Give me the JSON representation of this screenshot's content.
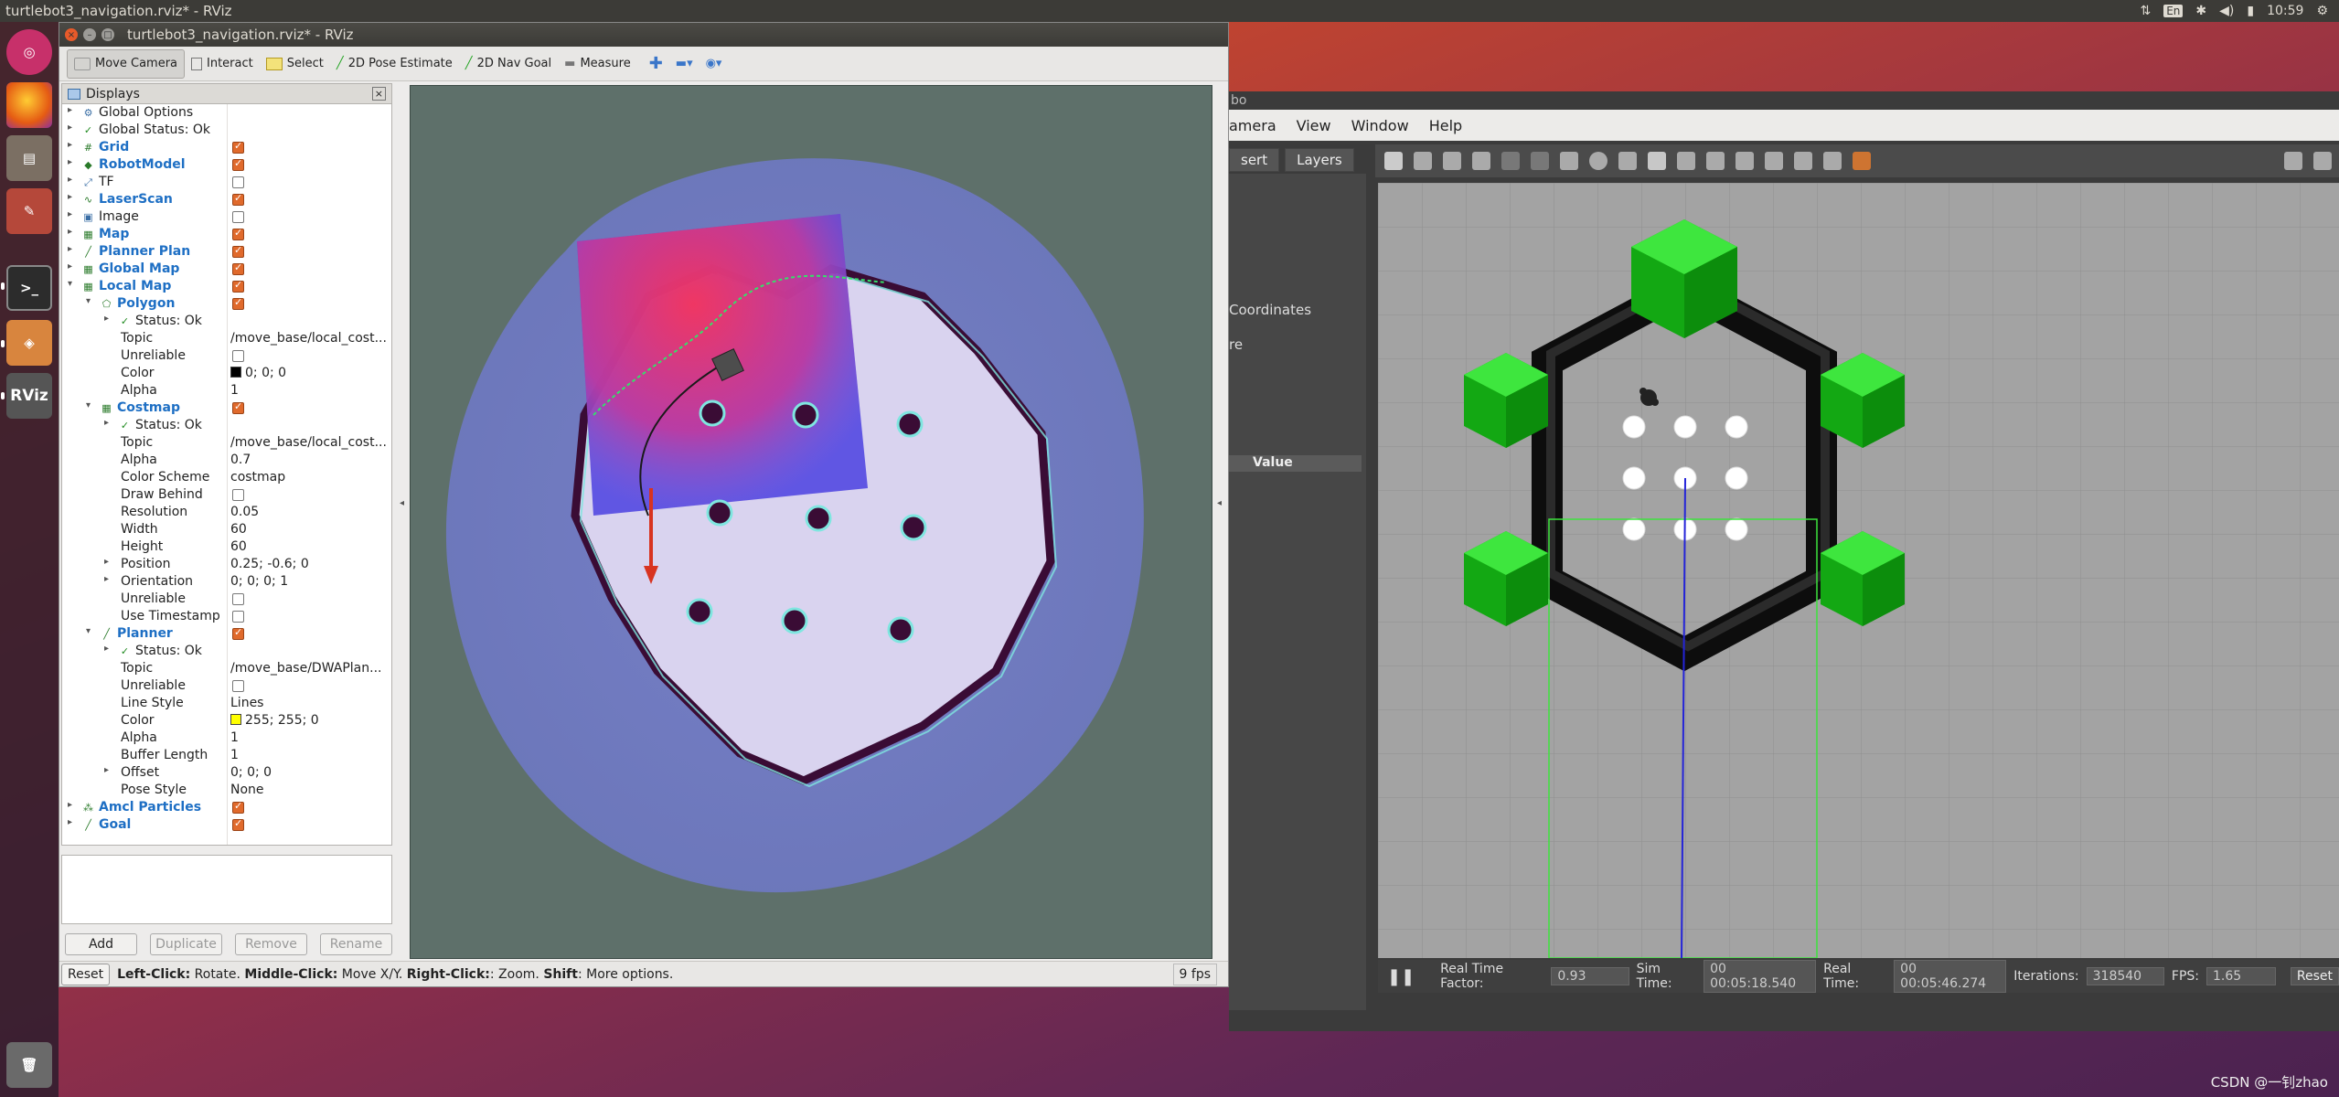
{
  "topbar": {
    "title": "turtlebot3_navigation.rviz* - RViz",
    "lang": "En",
    "clock": "10:59"
  },
  "rviz": {
    "title": "turtlebot3_navigation.rviz* - RViz",
    "toolbar": [
      "Move Camera",
      "Interact",
      "Select",
      "2D Pose Estimate",
      "2D Nav Goal",
      "Measure"
    ],
    "displays_title": "Displays",
    "tree": [
      {
        "d": 0,
        "a": "▸",
        "ic": "⚙",
        "lb": "Global Options",
        "bold": false,
        "cb": null,
        "val": ""
      },
      {
        "d": 0,
        "a": "▸",
        "ic": "✓",
        "lb": "Global Status: Ok",
        "bold": false,
        "cb": null,
        "val": ""
      },
      {
        "d": 0,
        "a": "▸",
        "ic": "#",
        "lb": "Grid",
        "bold": true,
        "cb": true,
        "val": ""
      },
      {
        "d": 0,
        "a": "▸",
        "ic": "◆",
        "lb": "RobotModel",
        "bold": true,
        "cb": true,
        "val": ""
      },
      {
        "d": 0,
        "a": "▸",
        "ic": "⤢",
        "lb": "TF",
        "bold": false,
        "cb": false,
        "val": ""
      },
      {
        "d": 0,
        "a": "▸",
        "ic": "∿",
        "lb": "LaserScan",
        "bold": true,
        "cb": true,
        "val": ""
      },
      {
        "d": 0,
        "a": "▸",
        "ic": "▣",
        "lb": "Image",
        "bold": false,
        "cb": false,
        "val": ""
      },
      {
        "d": 0,
        "a": "▸",
        "ic": "▦",
        "lb": "Map",
        "bold": true,
        "cb": true,
        "val": ""
      },
      {
        "d": 0,
        "a": "▸",
        "ic": "╱",
        "lb": "Planner Plan",
        "bold": true,
        "cb": true,
        "val": ""
      },
      {
        "d": 0,
        "a": "▸",
        "ic": "▦",
        "lb": "Global Map",
        "bold": true,
        "cb": true,
        "val": ""
      },
      {
        "d": 0,
        "a": "▾",
        "ic": "▦",
        "lb": "Local Map",
        "bold": true,
        "cb": true,
        "val": ""
      },
      {
        "d": 1,
        "a": "▾",
        "ic": "⬠",
        "lb": "Polygon",
        "bold": true,
        "cb": true,
        "val": ""
      },
      {
        "d": 2,
        "a": "▸",
        "ic": "✓",
        "lb": "Status: Ok",
        "bold": false,
        "cb": null,
        "val": ""
      },
      {
        "d": 2,
        "a": "",
        "ic": "",
        "lb": "Topic",
        "bold": false,
        "cb": null,
        "val": "/move_base/local_cost..."
      },
      {
        "d": 2,
        "a": "",
        "ic": "",
        "lb": "Unreliable",
        "bold": false,
        "cb": false,
        "val": ""
      },
      {
        "d": 2,
        "a": "",
        "ic": "",
        "lb": "Color",
        "bold": false,
        "cb": null,
        "val": "0; 0; 0",
        "sw": "#000000"
      },
      {
        "d": 2,
        "a": "",
        "ic": "",
        "lb": "Alpha",
        "bold": false,
        "cb": null,
        "val": "1"
      },
      {
        "d": 1,
        "a": "▾",
        "ic": "▦",
        "lb": "Costmap",
        "bold": true,
        "cb": true,
        "val": ""
      },
      {
        "d": 2,
        "a": "▸",
        "ic": "✓",
        "lb": "Status: Ok",
        "bold": false,
        "cb": null,
        "val": ""
      },
      {
        "d": 2,
        "a": "",
        "ic": "",
        "lb": "Topic",
        "bold": false,
        "cb": null,
        "val": "/move_base/local_cost..."
      },
      {
        "d": 2,
        "a": "",
        "ic": "",
        "lb": "Alpha",
        "bold": false,
        "cb": null,
        "val": "0.7"
      },
      {
        "d": 2,
        "a": "",
        "ic": "",
        "lb": "Color Scheme",
        "bold": false,
        "cb": null,
        "val": "costmap"
      },
      {
        "d": 2,
        "a": "",
        "ic": "",
        "lb": "Draw Behind",
        "bold": false,
        "cb": false,
        "val": ""
      },
      {
        "d": 2,
        "a": "",
        "ic": "",
        "lb": "Resolution",
        "bold": false,
        "cb": null,
        "val": "0.05"
      },
      {
        "d": 2,
        "a": "",
        "ic": "",
        "lb": "Width",
        "bold": false,
        "cb": null,
        "val": "60"
      },
      {
        "d": 2,
        "a": "",
        "ic": "",
        "lb": "Height",
        "bold": false,
        "cb": null,
        "val": "60"
      },
      {
        "d": 2,
        "a": "▸",
        "ic": "",
        "lb": "Position",
        "bold": false,
        "cb": null,
        "val": "0.25; -0.6; 0"
      },
      {
        "d": 2,
        "a": "▸",
        "ic": "",
        "lb": "Orientation",
        "bold": false,
        "cb": null,
        "val": "0; 0; 0; 1"
      },
      {
        "d": 2,
        "a": "",
        "ic": "",
        "lb": "Unreliable",
        "bold": false,
        "cb": false,
        "val": ""
      },
      {
        "d": 2,
        "a": "",
        "ic": "",
        "lb": "Use Timestamp",
        "bold": false,
        "cb": false,
        "val": ""
      },
      {
        "d": 1,
        "a": "▾",
        "ic": "╱",
        "lb": "Planner",
        "bold": true,
        "cb": true,
        "val": ""
      },
      {
        "d": 2,
        "a": "▸",
        "ic": "✓",
        "lb": "Status: Ok",
        "bold": false,
        "cb": null,
        "val": ""
      },
      {
        "d": 2,
        "a": "",
        "ic": "",
        "lb": "Topic",
        "bold": false,
        "cb": null,
        "val": "/move_base/DWAPlan..."
      },
      {
        "d": 2,
        "a": "",
        "ic": "",
        "lb": "Unreliable",
        "bold": false,
        "cb": false,
        "val": ""
      },
      {
        "d": 2,
        "a": "",
        "ic": "",
        "lb": "Line Style",
        "bold": false,
        "cb": null,
        "val": "Lines"
      },
      {
        "d": 2,
        "a": "",
        "ic": "",
        "lb": "Color",
        "bold": false,
        "cb": null,
        "val": "255; 255; 0",
        "sw": "#ffff00"
      },
      {
        "d": 2,
        "a": "",
        "ic": "",
        "lb": "Alpha",
        "bold": false,
        "cb": null,
        "val": "1"
      },
      {
        "d": 2,
        "a": "",
        "ic": "",
        "lb": "Buffer Length",
        "bold": false,
        "cb": null,
        "val": "1"
      },
      {
        "d": 2,
        "a": "▸",
        "ic": "",
        "lb": "Offset",
        "bold": false,
        "cb": null,
        "val": "0; 0; 0"
      },
      {
        "d": 2,
        "a": "",
        "ic": "",
        "lb": "Pose Style",
        "bold": false,
        "cb": null,
        "val": "None"
      },
      {
        "d": 0,
        "a": "▸",
        "ic": "⁂",
        "lb": "Amcl Particles",
        "bold": true,
        "cb": true,
        "val": ""
      },
      {
        "d": 0,
        "a": "▸",
        "ic": "╱",
        "lb": "Goal",
        "bold": true,
        "cb": true,
        "val": ""
      }
    ],
    "panel_buttons": {
      "add": "Add",
      "duplicate": "Duplicate",
      "remove": "Remove",
      "rename": "Rename"
    },
    "status": {
      "reset": "Reset",
      "k1": "Left-Click:",
      "t1": " Rotate. ",
      "k2": "Middle-Click:",
      "t2": " Move X/Y. ",
      "k3": "Right-Click:",
      "t3": ": Zoom. ",
      "k4": "Shift",
      "t4": ": More options.",
      "fps": "9 fps"
    }
  },
  "gazebo": {
    "title_frag": "bo",
    "menu": [
      "amera",
      "View",
      "Window",
      "Help"
    ],
    "tabs": [
      "sert",
      "Layers"
    ],
    "left_items": [
      "Coordinates",
      "re"
    ],
    "value_header": "Value",
    "stats": {
      "rtf_label": "Real Time Factor:",
      "rtf": "0.93",
      "sim_label": "Sim Time:",
      "sim": "00 00:05:18.540",
      "real_label": "Real Time:",
      "real": "00 00:05:46.274",
      "it_label": "Iterations:",
      "it": "318540",
      "fps_label": "FPS:",
      "fps": "1.65",
      "reset": "Reset"
    }
  },
  "watermark": "CSDN @一钊zhao"
}
